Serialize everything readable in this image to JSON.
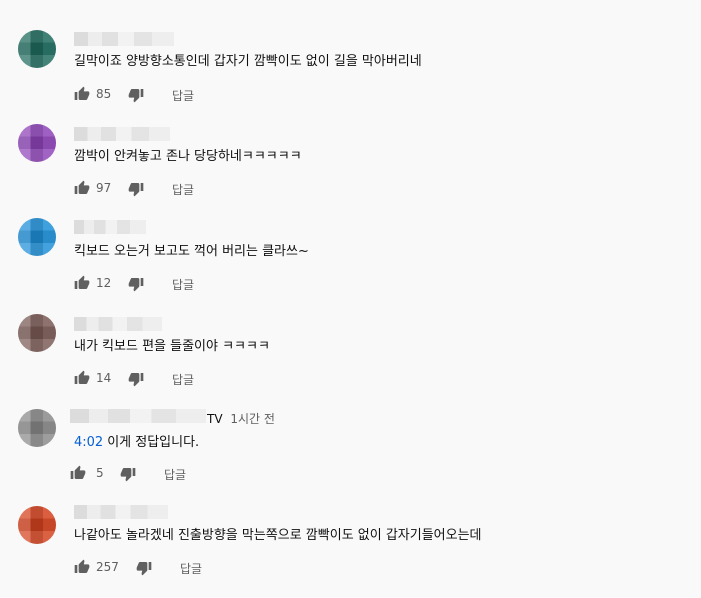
{
  "comments": [
    {
      "avatar_color": "#1f6b5e",
      "author_suffix": "",
      "time": "",
      "timestamp_link": "",
      "text": "길막이죠 양방향소통인데 갑자기 깜빡이도 없이 길을 막아버리네",
      "likes": "85",
      "reply_label": "답글"
    },
    {
      "avatar_color": "#8e44b8",
      "author_suffix": "",
      "time": "",
      "timestamp_link": "",
      "text": "깜박이 안켜놓고 존나 당당하네ㅋㅋㅋㅋㅋ",
      "likes": "97",
      "reply_label": "답글"
    },
    {
      "avatar_color": "#1e90d8",
      "author_suffix": "",
      "time": "",
      "timestamp_link": "",
      "text": "킥보드 오는거 보고도 꺽어 버리는 클라쓰~",
      "likes": "12",
      "reply_label": "답글"
    },
    {
      "avatar_color": "#7a5a55",
      "author_suffix": "",
      "time": "",
      "timestamp_link": "",
      "text": "내가 킥보드 편을 들줄이야 ㅋㅋㅋㅋ",
      "likes": "14",
      "reply_label": "답글"
    },
    {
      "avatar_color": "#8a8a8a",
      "author_suffix": "TV",
      "time": "1시간 전",
      "timestamp_link": "4:02",
      "text": "이게 정답입니다.",
      "likes": "5",
      "reply_label": "답글"
    },
    {
      "avatar_color": "#d4421e",
      "author_suffix": "",
      "time": "",
      "timestamp_link": "",
      "text": "나같아도 놀라겠네 진출방향을 막는쪽으로 깜빡이도 없이 갑자기들어오는데",
      "likes": "257",
      "reply_label": "답글"
    }
  ],
  "icons": {
    "like": "thumb-up-icon",
    "dislike": "thumb-down-icon"
  }
}
